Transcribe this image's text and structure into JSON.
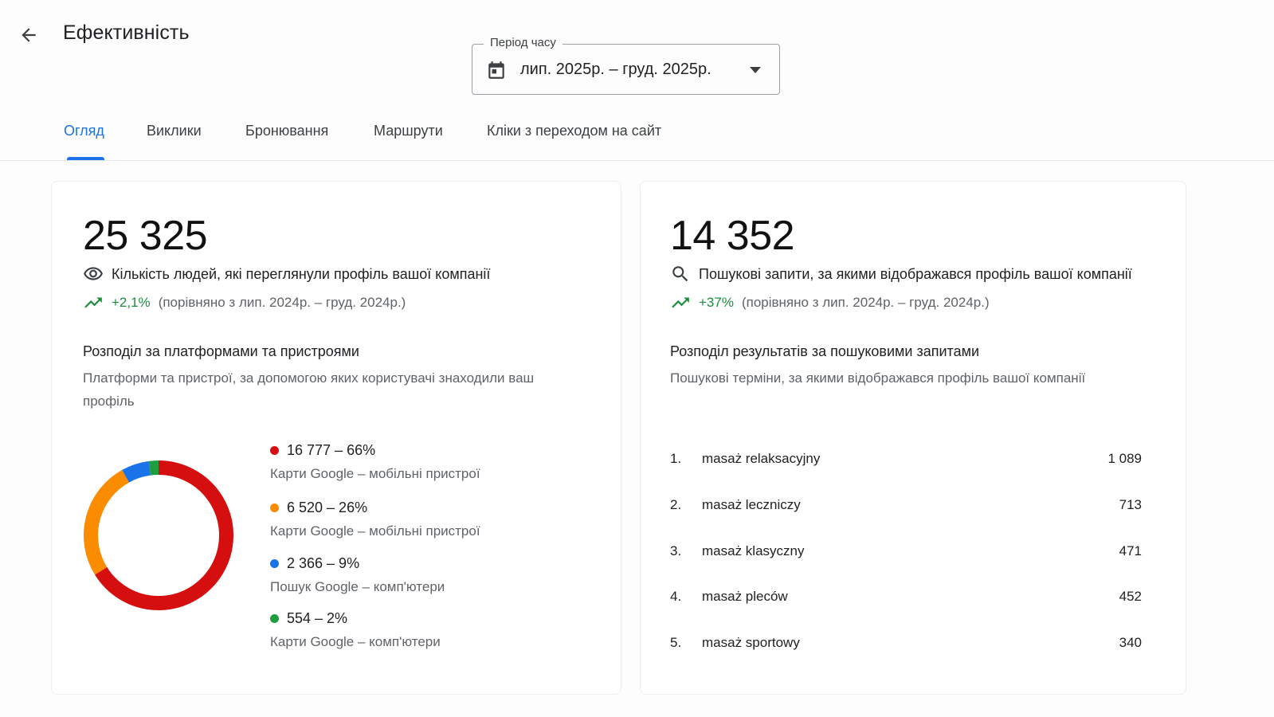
{
  "header": {
    "title": "Ефективність",
    "back_icon": "arrow-back-icon"
  },
  "period": {
    "label": "Період часу",
    "value": "лип. 2025р. – груд. 2025р.",
    "icon": "calendar-icon"
  },
  "tabs": [
    {
      "label": "Огляд",
      "active": true
    },
    {
      "label": "Виклики",
      "active": false
    },
    {
      "label": "Бронювання",
      "active": false
    },
    {
      "label": "Маршрути",
      "active": false
    },
    {
      "label": "Кліки з переходом на сайт",
      "active": false
    }
  ],
  "views_card": {
    "total": "25 325",
    "description": "Кількість людей, які переглянули профіль вашої компанії",
    "delta": "+2,1%",
    "comparison": "(порівняно з лип. 2024р. – груд. 2024р.)",
    "section_title": "Розподіл за платформами та пристроями",
    "section_subtitle": "Платформи та пристрої, за допомогою яких користувачі знаходили ваш профіль",
    "breakdown": [
      {
        "value": "16 777 – 66%",
        "label": "Карти Google – мобільні пристрої",
        "share": 66.2,
        "color": "#d50f0f"
      },
      {
        "value": "6 520 – 26%",
        "label": "Карти Google – мобільні пристрої",
        "share": 25.7,
        "color": "#fb8c00"
      },
      {
        "value": "2 366 – 9%",
        "label": "Пошук Google – комп'ютери",
        "share": 6.0,
        "color": "#1a73e8"
      },
      {
        "value": "554 – 2%",
        "label": "Карти Google – комп'ютери",
        "share": 2.1,
        "color": "#1e9e3e"
      }
    ]
  },
  "searches_card": {
    "total": "14 352",
    "description": "Пошукові запити, за якими відображався профіль вашої компанії",
    "delta": "+37%",
    "comparison": "(порівняно з лип. 2024р. – груд. 2024р.)",
    "section_title": "Розподіл результатів за пошуковими запитами",
    "section_subtitle": "Пошукові терміни, за якими відображався профіль вашої компанії",
    "queries": [
      {
        "rank": "1.",
        "term": "masaż relaksacyjny",
        "count": "1 089"
      },
      {
        "rank": "2.",
        "term": "masaż leczniczy",
        "count": "713"
      },
      {
        "rank": "3.",
        "term": "masaż klasyczny",
        "count": "471"
      },
      {
        "rank": "4.",
        "term": "masaż pleców",
        "count": "452"
      },
      {
        "rank": "5.",
        "term": "masaż sportowy",
        "count": "340"
      }
    ]
  },
  "colors": {
    "accent": "#1a73e8",
    "positive": "#1e8e3e"
  }
}
